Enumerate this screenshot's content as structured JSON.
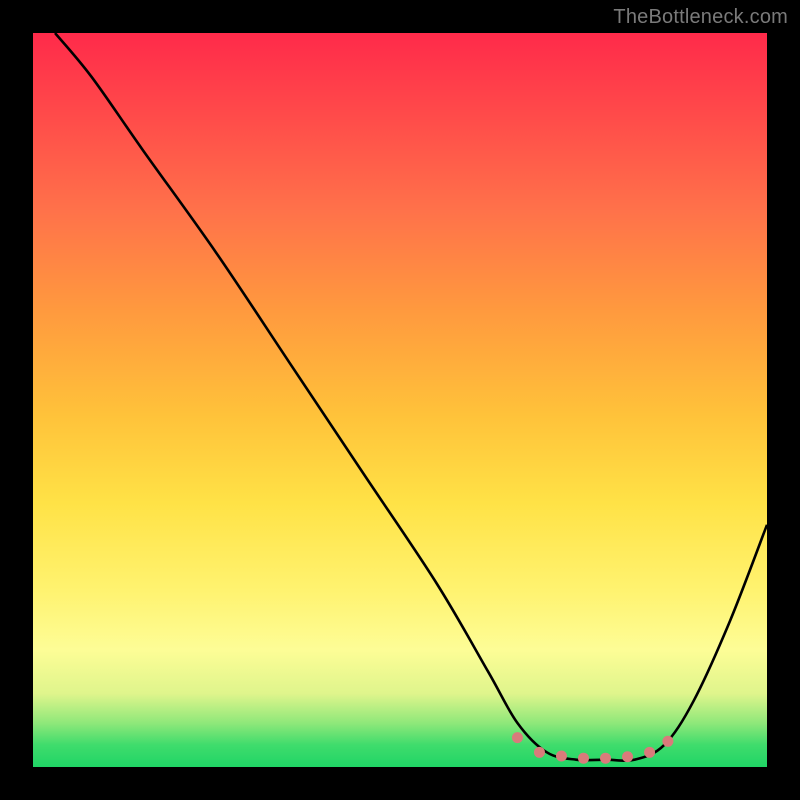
{
  "watermark": "TheBottleneck.com",
  "chart_data": {
    "type": "line",
    "title": "",
    "xlabel": "",
    "ylabel": "",
    "xlim": [
      0,
      1
    ],
    "ylim": [
      0,
      1
    ],
    "series": [
      {
        "name": "main-curve",
        "x": [
          0.03,
          0.08,
          0.15,
          0.25,
          0.35,
          0.45,
          0.55,
          0.62,
          0.66,
          0.7,
          0.74,
          0.78,
          0.82,
          0.86,
          0.9,
          0.95,
          1.0
        ],
        "y": [
          1.0,
          0.94,
          0.84,
          0.7,
          0.55,
          0.4,
          0.25,
          0.13,
          0.06,
          0.02,
          0.01,
          0.01,
          0.01,
          0.03,
          0.09,
          0.2,
          0.33
        ]
      },
      {
        "name": "dotted-segment",
        "x": [
          0.66,
          0.69,
          0.72,
          0.75,
          0.78,
          0.81,
          0.84,
          0.865
        ],
        "y": [
          0.04,
          0.02,
          0.015,
          0.012,
          0.012,
          0.014,
          0.02,
          0.035
        ]
      }
    ],
    "annotations": []
  },
  "colors": {
    "curve_stroke": "#000000",
    "dot_fill": "#d97b7b"
  }
}
